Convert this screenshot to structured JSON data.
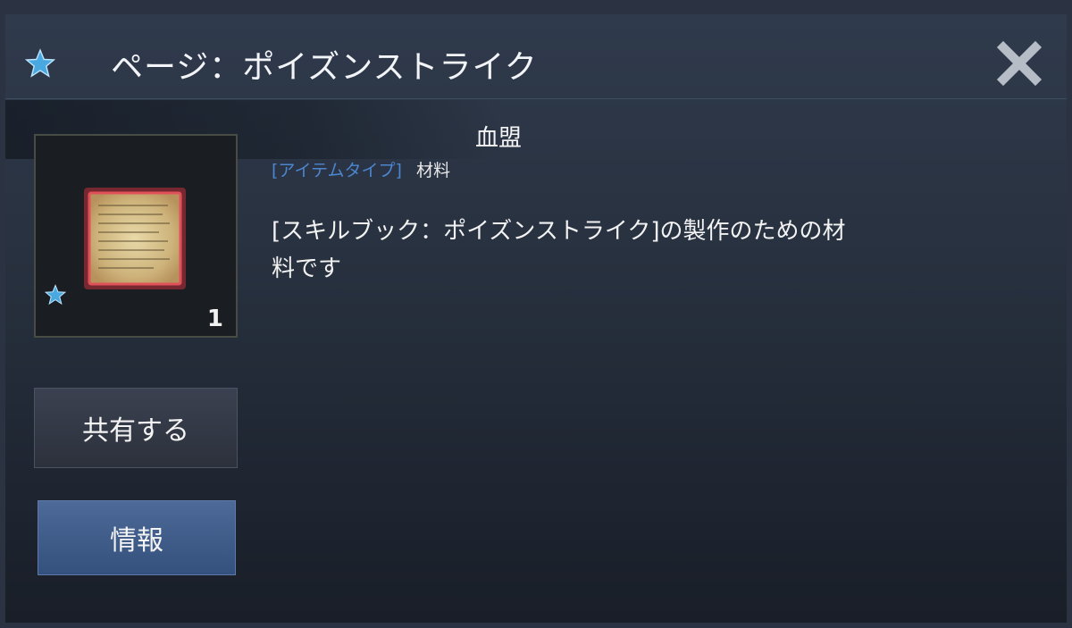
{
  "window": {
    "title": "ページ：ポイズンストライク",
    "star_icon": "star-icon",
    "close_icon": "close-icon"
  },
  "item": {
    "name": "血盟",
    "type_label": "[アイテムタイプ]",
    "type_value": "材料",
    "description": "[スキルブック：ポイズンストライク]の製作のための材料です",
    "count": "1",
    "icon": "parchment-page-icon"
  },
  "buttons": {
    "share_label": "共有する",
    "info_label": "情報"
  },
  "colors": {
    "type_label": "#4c86cf",
    "info_button": "#3f5c8a",
    "star": "#4aa8e0"
  }
}
